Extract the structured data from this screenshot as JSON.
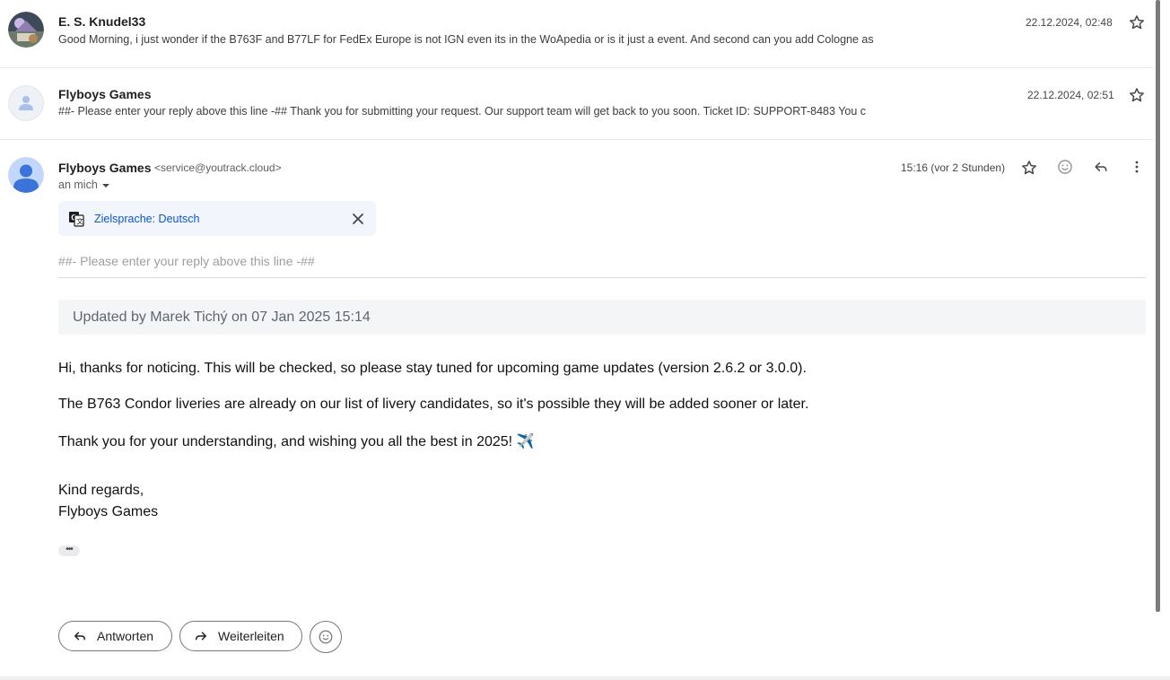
{
  "messages": [
    {
      "sender": "E. S. Knudel33",
      "snippet": "Good Morning, i just wonder if the B763F and B77LF for FedEx Europe is not IGN even its in the WoApedia or is it just a event. And second can you add Cologne as",
      "date": "22.12.2024, 02:48"
    },
    {
      "sender": "Flyboys Games",
      "snippet": "##- Please enter your reply above this line -## Thank you for submitting your request. Our support team will get back to you soon. Ticket ID: SUPPORT-8483 You c",
      "date": "22.12.2024, 02:51"
    }
  ],
  "open_message": {
    "sender": "Flyboys Games",
    "email": "<service@youtrack.cloud>",
    "recipient": "an mich",
    "time": "15:16 (vor 2 Stunden)",
    "translate_label": "Zielsprache: Deutsch",
    "reply_line": "##- Please enter your reply above this line -##",
    "update_header": "Updated by Marek Tichý on 07 Jan 2025 15:14",
    "paragraphs": [
      "Hi, thanks for noticing. This will be checked, so please stay tuned for upcoming game updates (version 2.6.2 or 3.0.0).",
      "The B763 Condor liveries are already on our list of livery candidates, so it's possible they will be added sooner or later.",
      "Thank you for your understanding, and wishing you all the best in 2025! ✈️",
      "Kind regards,",
      "Flyboys Games"
    ],
    "ellipsis": "•••"
  },
  "actions": {
    "reply_label": "Antworten",
    "forward_label": "Weiterleiten"
  },
  "icons": {
    "star": "star-icon",
    "emoji": "emoji-icon",
    "reply": "reply-icon",
    "more": "more-vert-icon",
    "translate": "translate-icon",
    "close": "close-icon",
    "forward": "forward-icon"
  },
  "colors": {
    "link_blue": "#0b57d0",
    "translate_bg": "#f2f5fb",
    "avatar_blue": "#4a80e8"
  }
}
